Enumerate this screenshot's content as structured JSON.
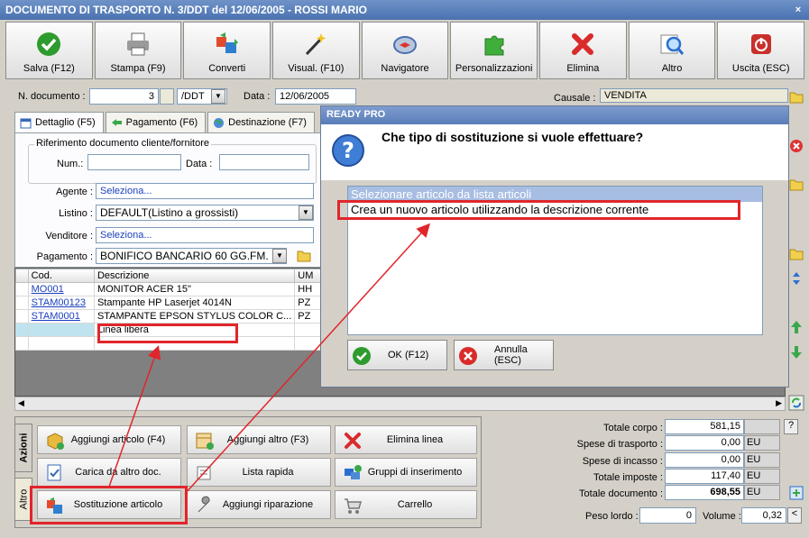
{
  "window": {
    "title": "DOCUMENTO DI TRASPORTO N. 3/DDT del 12/06/2005 - ROSSI MARIO",
    "close_glyph": "×"
  },
  "toolbar": [
    {
      "label": "Salva (F12)",
      "icon": "check-icon",
      "color": "#2e9b2e"
    },
    {
      "label": "Stampa (F9)",
      "icon": "printer-icon",
      "color": "#7a7a7a"
    },
    {
      "label": "Converti",
      "icon": "convert-icon",
      "color": "#3a78c2"
    },
    {
      "label": "Visual. (F10)",
      "icon": "magic-wand-icon",
      "color": "#444444"
    },
    {
      "label": "Navigatore",
      "icon": "compass-icon",
      "color": "#4a6fb0"
    },
    {
      "label": "Personalizzazioni",
      "icon": "puzzle-icon",
      "color": "#3fae3a"
    },
    {
      "label": "Elimina",
      "icon": "delete-x-icon",
      "color": "#d92b2b"
    },
    {
      "label": "Altro",
      "icon": "magnifier-icon",
      "color": "#2a6fd0"
    },
    {
      "label": "Uscita (ESC)",
      "icon": "power-icon",
      "color": "#c8302c"
    }
  ],
  "header": {
    "doc_num_label": "N. documento :",
    "doc_num_value": "3",
    "doc_series": "/DDT",
    "date_label": "Data :",
    "date_value": "12/06/2005",
    "causale_label": "Causale :",
    "causale_value": "VENDITA"
  },
  "tabs": [
    {
      "label": "Dettaglio (F5)"
    },
    {
      "label": "Pagamento (F6)"
    },
    {
      "label": "Destinazione (F7)"
    }
  ],
  "details": {
    "rif_label": "Riferimento documento cliente/fornitore",
    "num_label": "Num.:",
    "num_value": "",
    "data_label": "Data :",
    "data_value": "",
    "agente_label": "Agente :",
    "agente_value": "Seleziona...",
    "listino_label": "Listino :",
    "listino_value": "DEFAULT(Listino a grossisti)",
    "venditore_label": "Venditore :",
    "venditore_value": "Seleziona...",
    "pagamento_label": "Pagamento :",
    "pagamento_value": "BONIFICO BANCARIO 60 GG.FM."
  },
  "grid": {
    "columns": [
      "Cod.",
      "Descrizione",
      "UM"
    ],
    "rows": [
      {
        "cod": "MO001",
        "desc": "MONITOR ACER 15\"",
        "um": "HH"
      },
      {
        "cod": "STAM00123",
        "desc": "Stampante HP Laserjet 4014N",
        "um": "PZ"
      },
      {
        "cod": "STAM0001",
        "desc": "STAMPANTE EPSON STYLUS COLOR C...",
        "um": "PZ"
      },
      {
        "cod": "",
        "desc": "Linea libera",
        "um": ""
      }
    ]
  },
  "actions": {
    "tab_azioni": "Azioni",
    "tab_altro": "Altro",
    "buttons": [
      {
        "label": "Aggiungi articolo (F4)"
      },
      {
        "label": "Aggiungi altro (F3)"
      },
      {
        "label": "Elimina linea"
      },
      {
        "label": "Carica da altro doc."
      },
      {
        "label": "Lista rapida"
      },
      {
        "label": "Gruppi di inserimento"
      },
      {
        "label": "Sostituzione articolo"
      },
      {
        "label": "Aggiungi riparazione"
      },
      {
        "label": "Carrello"
      }
    ]
  },
  "totals": {
    "corpo_label": "Totale corpo :",
    "corpo_value": "581,15",
    "trasporto_label": "Spese di trasporto :",
    "trasporto_value": "0,00",
    "incasso_label": "Spese di incasso :",
    "incasso_value": "0,00",
    "imposte_label": "Totale imposte :",
    "imposte_value": "117,40",
    "documento_label": "Totale documento :",
    "documento_value": "698,55",
    "currency": "EU",
    "peso_label": "Peso lordo :",
    "peso_value": "0",
    "volume_label": "Volume :",
    "volume_value": "0,32",
    "help": "?",
    "volume_btn": "<"
  },
  "dialog": {
    "title": "READY PRO",
    "question": "Che tipo di sostituzione si vuole effettuare?",
    "options": [
      "Selezionare articolo da lista articoli",
      "Crea un nuovo articolo utilizzando la descrizione corrente"
    ],
    "ok_label": "OK (F12)",
    "cancel_label": "Annulla (ESC)"
  }
}
